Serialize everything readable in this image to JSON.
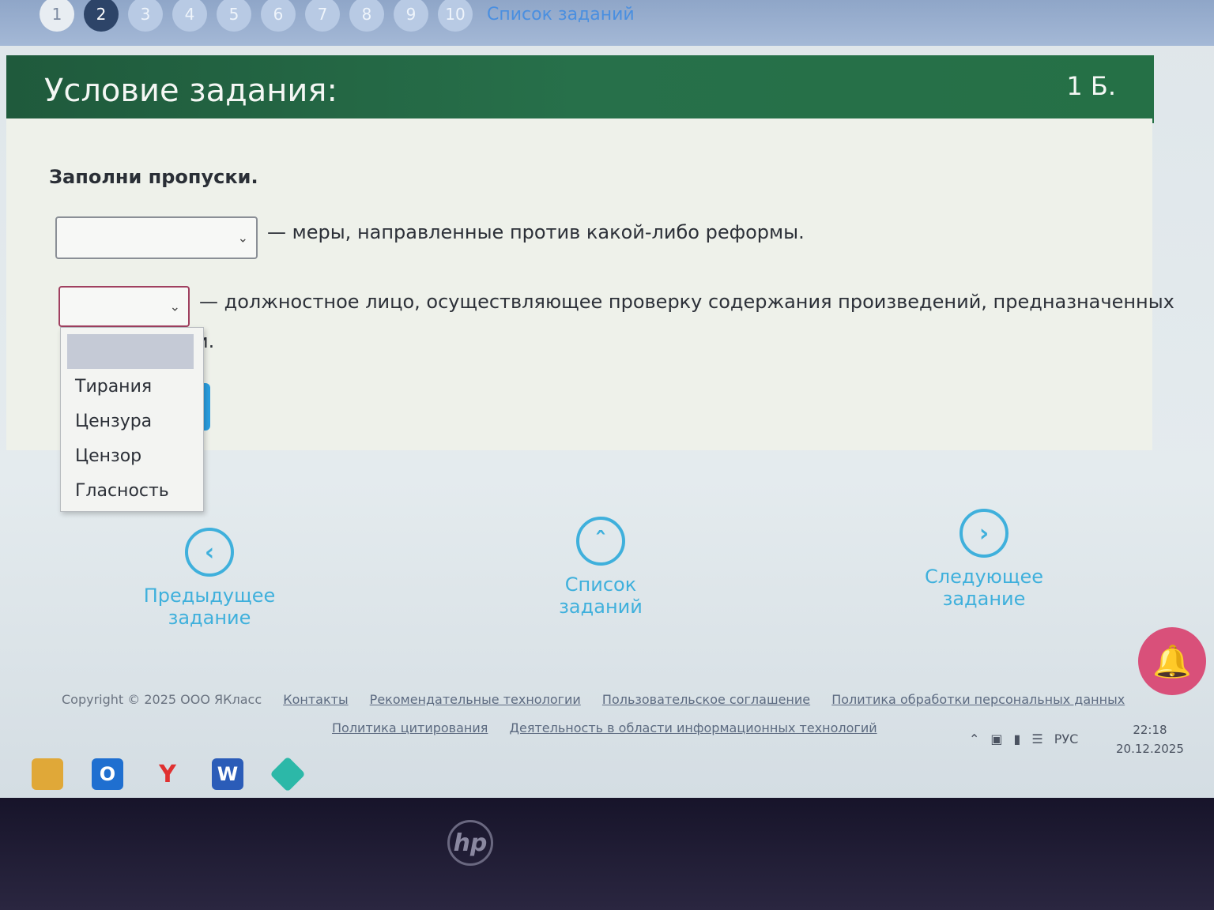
{
  "pagination": {
    "pages": [
      "1",
      "2",
      "3",
      "4",
      "5",
      "6",
      "7",
      "8",
      "9",
      "10"
    ],
    "active_index": 1,
    "task_list_label": "Список заданий"
  },
  "header": {
    "title": "Условие задания:",
    "points": "1 Б."
  },
  "task": {
    "instruction": "Заполни пропуски.",
    "sentence1": "— меры, направленные против какой-либо реформы.",
    "sentence2": "— должностное лицо, осуществляющее проверку содержания произведений, предназначенных",
    "sentence2_end": "и."
  },
  "dropdown": {
    "options": [
      "Тирания",
      "Цензура",
      "Цензор",
      "Гласность"
    ]
  },
  "navigation": {
    "prev_label": "Предыдущее задание",
    "list_label": "Список заданий",
    "next_label": "Следующее задание"
  },
  "footer": {
    "copyright": "Copyright © 2025 ООО ЯКласс",
    "links": [
      "Контакты",
      "Рекомендательные технологии",
      "Пользовательское соглашение",
      "Политика обработки персональных данных"
    ],
    "links2": [
      "Политика цитирования",
      "Деятельность в области информационных технологий"
    ]
  },
  "system_tray": {
    "language": "РУС",
    "time": "22:18",
    "date": "20.12.2025"
  },
  "icons": {
    "prev": "chevron-left-icon",
    "list": "chevron-up-icon",
    "next": "chevron-right-icon",
    "bell": "bell-icon"
  },
  "colors": {
    "header_green": "#27704a",
    "link_blue": "#3fb0dc",
    "bell_pink": "#d9507a",
    "active_page": "#2d4468"
  }
}
